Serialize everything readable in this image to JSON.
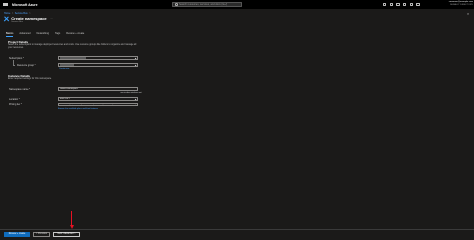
{
  "topbar": {
    "brand": "Microsoft Azure",
    "search_placeholder": "Search resources, services, and docs (G+/)",
    "account_email": "someone@example.com",
    "account_tenant": "DEFAULT DIRECTORY"
  },
  "breadcrumb": [
    "Home",
    "Service Bus"
  ],
  "page": {
    "title": "Create namespace",
    "subtitle": "Service Bus",
    "more": "...",
    "close": "×"
  },
  "tabs": [
    {
      "label": "Basics",
      "active": true
    },
    {
      "label": "Advanced",
      "active": false
    },
    {
      "label": "Networking",
      "active": false
    },
    {
      "label": "Tags",
      "active": false
    },
    {
      "label": "Review + create",
      "active": false
    }
  ],
  "project_details": {
    "heading": "Project Details",
    "description": "Select the subscription to manage deployed resources and costs. Use resource groups like folders to organize and manage all your resources.",
    "subscription_label": "Subscription *",
    "resource_group_label": "Resource group *",
    "create_new": "Create new"
  },
  "instance_details": {
    "heading": "Instance Details",
    "description": "Enter required settings for this namespace.",
    "namespace_label": "Namespace name *",
    "namespace_value": "Name-namespace",
    "namespace_validation": ".servicebus.windows.net",
    "location_label": "Location *",
    "location_value": "East US 2",
    "pricing_label": "Pricing tier *",
    "pricing_value": "Standard (~$10 USD per 12.5M Operations per Month)",
    "pricing_link": "Browse the available plans and their features"
  },
  "footer": {
    "review_create": "Review + create",
    "previous": "< Previous",
    "next": "Next: Advanced >"
  },
  "colors": {
    "accent": "#0f6cbd",
    "link": "#4da3ff",
    "annotation_arrow": "#e81123"
  }
}
